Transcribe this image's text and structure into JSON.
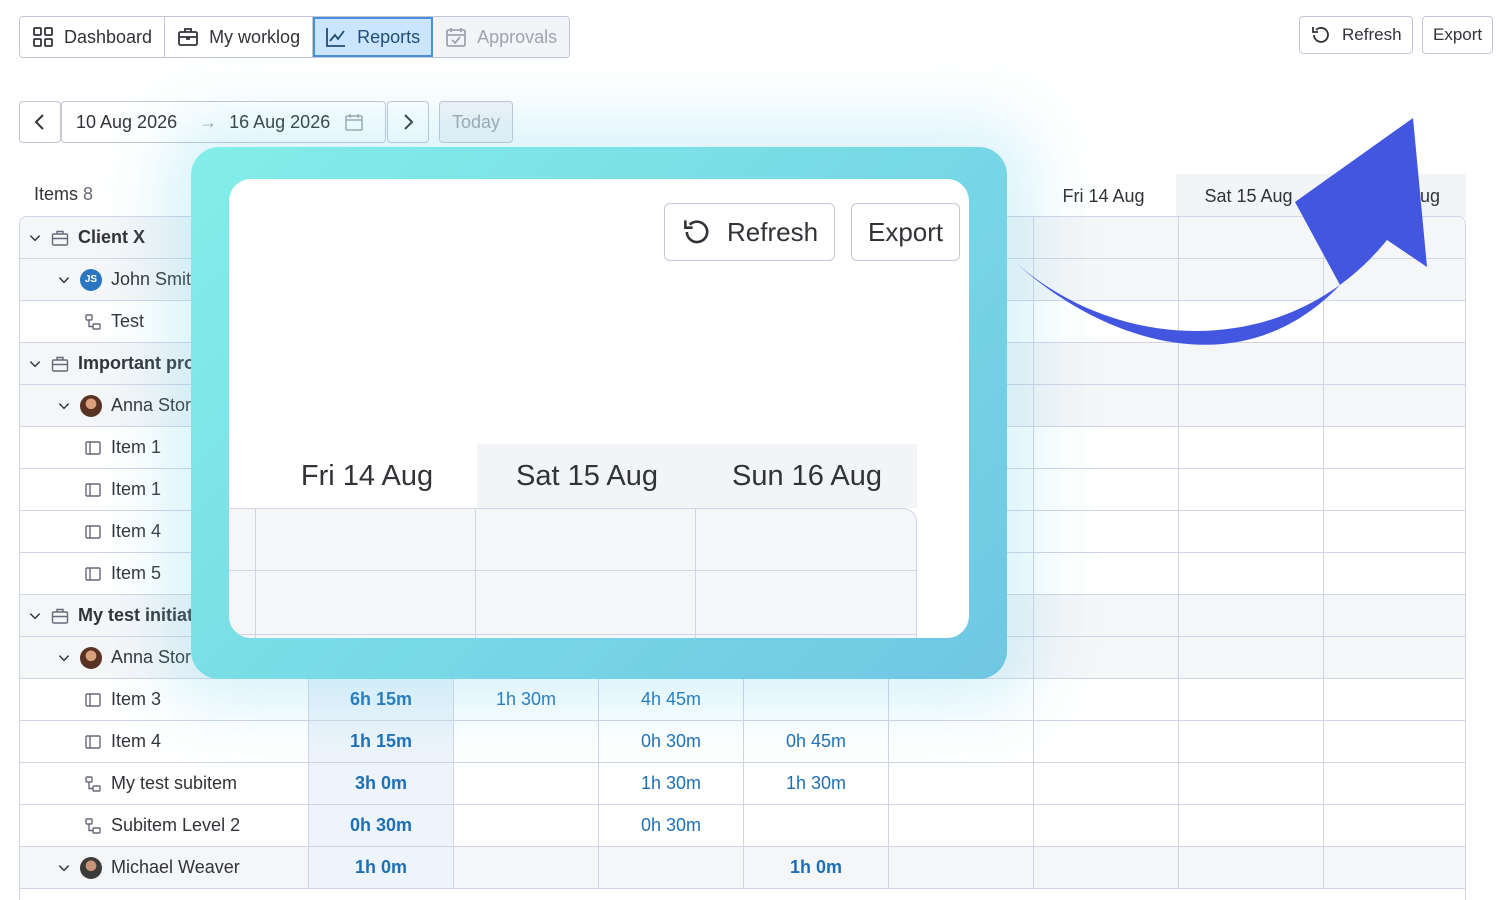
{
  "tabs": [
    {
      "label": "Dashboard",
      "icon": "grid-icon",
      "state": "normal"
    },
    {
      "label": "My worklog",
      "icon": "briefcase-icon",
      "state": "normal"
    },
    {
      "label": "Reports",
      "icon": "line-chart-icon",
      "state": "active"
    },
    {
      "label": "Approvals",
      "icon": "calendar-check-icon",
      "state": "disabled"
    }
  ],
  "toolbar": {
    "refresh_label": "Refresh",
    "export_label": "Export"
  },
  "date_range": {
    "start": "10 Aug 2026",
    "arrow": "→",
    "end": "16 Aug 2026",
    "today_label": "Today"
  },
  "table": {
    "items_label": "Items",
    "items_count": "8",
    "visible_day_headers": [
      "Fri 14 Aug",
      "Sat 15 Aug",
      "ug"
    ],
    "rows": [
      {
        "label": "Client X",
        "type": "group",
        "icon": "briefcase-icon",
        "values": []
      },
      {
        "label": "John Smit",
        "type": "person",
        "avatar_initials": "JS",
        "values": []
      },
      {
        "label": "Test",
        "type": "subitem",
        "icon": "subitem-icon",
        "values": []
      },
      {
        "label": "Important pro",
        "type": "group",
        "icon": "briefcase-icon",
        "values": []
      },
      {
        "label": "Anna Stor",
        "type": "person",
        "values": []
      },
      {
        "label": "Item 1",
        "type": "item",
        "icon": "item-icon",
        "values": []
      },
      {
        "label": "Item 1",
        "type": "item",
        "icon": "item-icon",
        "values": []
      },
      {
        "label": "Item 4",
        "type": "item",
        "icon": "item-icon",
        "values": []
      },
      {
        "label": "Item 5",
        "type": "item",
        "icon": "item-icon",
        "values": []
      },
      {
        "label": "My test initiat",
        "type": "group",
        "icon": "briefcase-icon",
        "values": []
      },
      {
        "label": "Anna Stor",
        "type": "person",
        "values": []
      },
      {
        "label": "Item 3",
        "type": "item",
        "icon": "item-icon",
        "values": [
          "6h 15m",
          "1h 30m",
          "4h 45m",
          ""
        ]
      },
      {
        "label": "Item 4",
        "type": "item",
        "icon": "item-icon",
        "values": [
          "1h 15m",
          "",
          "0h 30m",
          "0h 45m"
        ]
      },
      {
        "label": "My test subitem",
        "type": "subitem",
        "icon": "subitem-icon",
        "values": [
          "3h 0m",
          "",
          "1h 30m",
          "1h 30m"
        ]
      },
      {
        "label": "Subitem Level 2",
        "type": "subitem",
        "icon": "subitem-icon",
        "values": [
          "0h 30m",
          "",
          "0h 30m",
          ""
        ]
      },
      {
        "label": "Michael Weaver",
        "type": "person",
        "values": [
          "1h 0m",
          "",
          "",
          "1h 0m"
        ]
      }
    ]
  },
  "zoom": {
    "refresh_label": "Refresh",
    "export_label": "Export",
    "day_headers": [
      "Fri 14 Aug",
      "Sat 15 Aug",
      "Sun 16 Aug"
    ]
  },
  "colors": {
    "accent": "#1f6fb5",
    "active_tab": "#cce5ff",
    "arrow": "#4356e0",
    "zoom_frame": "#7fe3e8"
  }
}
